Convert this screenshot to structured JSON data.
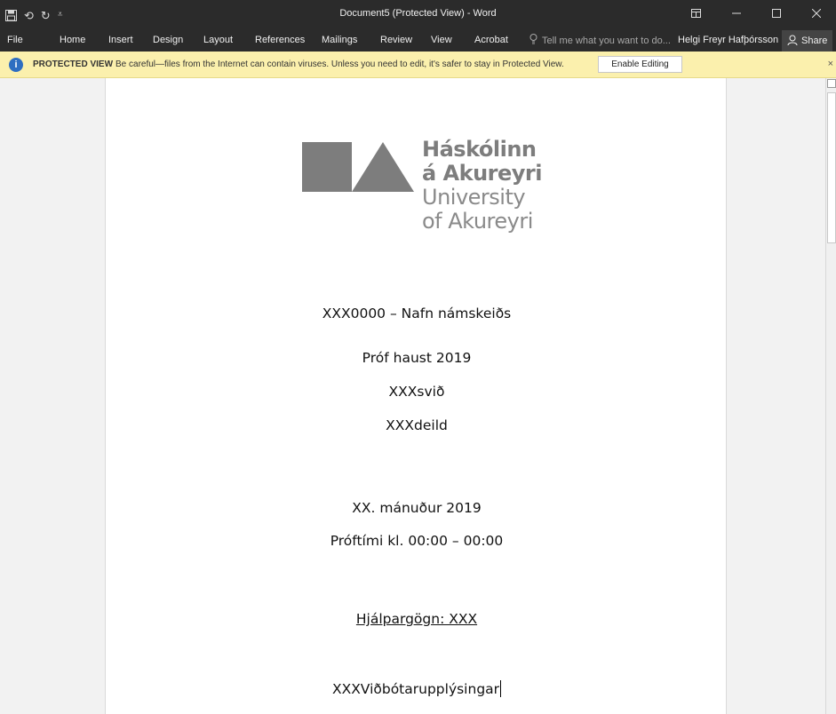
{
  "window": {
    "title": "Document5 (Protected View) - Word",
    "controls": {
      "ribbon_display": "ribbon-display-icon",
      "minimize": "minimize-icon",
      "maximize": "maximize-icon",
      "close": "close-icon"
    }
  },
  "qat": {
    "save": "save-icon",
    "undo": "undo-icon",
    "redo": "redo-icon",
    "customize": "customize-qat-icon"
  },
  "ribbon": {
    "tabs": [
      "File",
      "Home",
      "Insert",
      "Design",
      "Layout",
      "References",
      "Mailings",
      "Review",
      "View",
      "Acrobat"
    ],
    "tell_me": "Tell me what you want to do...",
    "user": "Helgi Freyr Hafþórsson",
    "share": "Share"
  },
  "protected_view": {
    "label": "PROTECTED VIEW",
    "message": "Be careful—files from the Internet can contain viruses. Unless you need to edit, it's safer to stay in Protected View.",
    "button": "Enable Editing",
    "close": "×"
  },
  "document": {
    "logo": {
      "line1": "Háskólinn",
      "line2": "á Akureyri",
      "line3": "University",
      "line4": "of Akureyri",
      "color": "#7d7d7d"
    },
    "course": "XXX0000 – Nafn námskeiðs",
    "exam": "Próf haust 2019",
    "school": "XXXsvið",
    "department": "XXXdeild",
    "date": "XX. mánuður 2019",
    "time": "Próftími kl. 00:00 – 00:00",
    "aids": "Hjálpargögn: XXX",
    "additional": "XXXViðbótarupplýsingar"
  },
  "colors": {
    "titlebar": "#2b2b2b",
    "protected_bar": "#fbf0ad",
    "info_icon": "#2e6ec1"
  }
}
